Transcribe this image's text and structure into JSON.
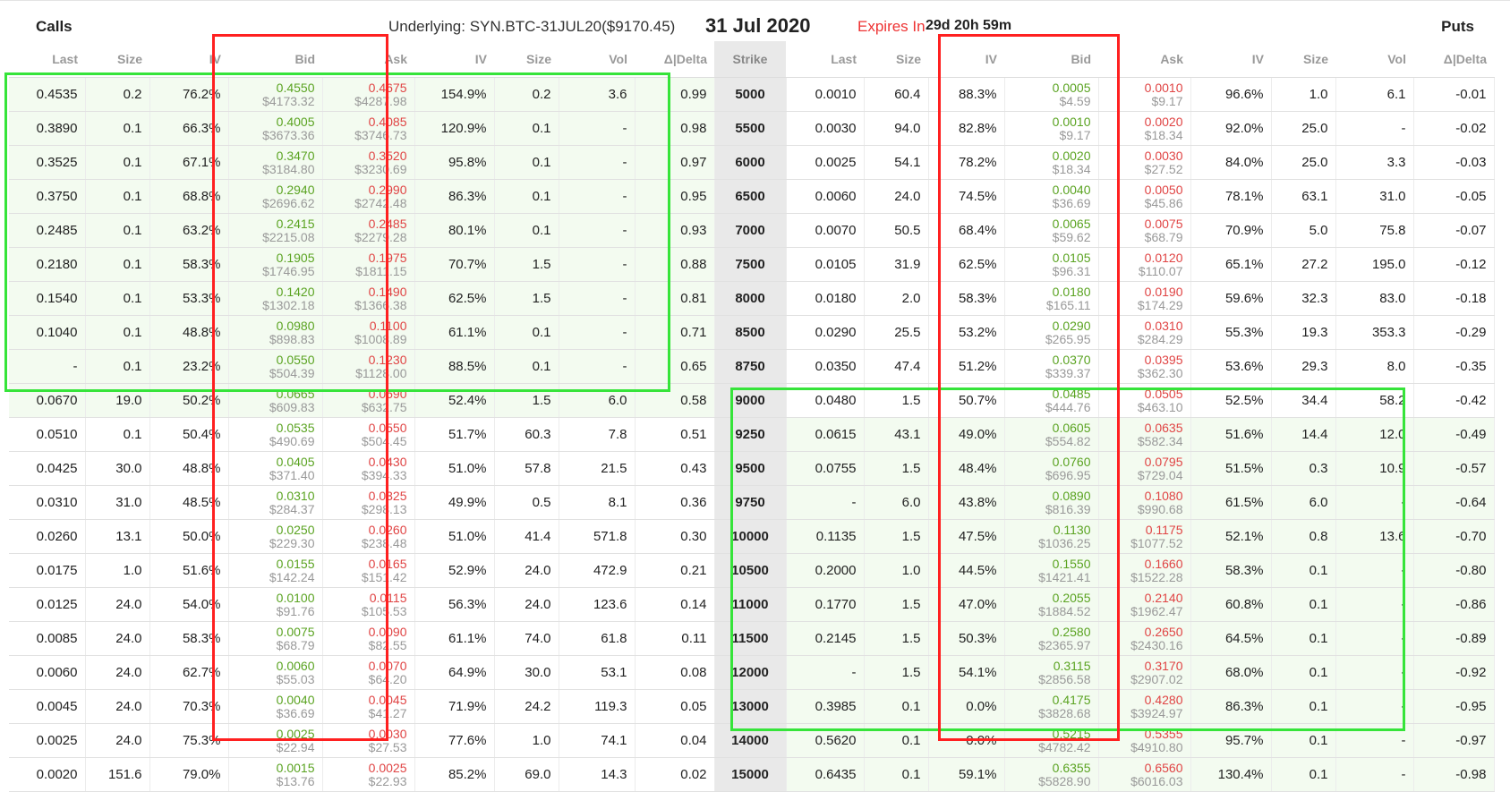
{
  "header": {
    "calls_label": "Calls",
    "puts_label": "Puts",
    "underlying": "Underlying: SYN.BTC-31JUL20($9170.45)",
    "expiry_date": "31 Jul 2020",
    "expires_in_label": "Expires In",
    "expires_in_value": "29d 20h 59m"
  },
  "columns": {
    "calls": [
      "Last",
      "Size",
      "IV",
      "Bid",
      "Ask",
      "IV",
      "Size",
      "Vol",
      "Δ|Delta"
    ],
    "strike": "Strike",
    "puts": [
      "Last",
      "Size",
      "IV",
      "Bid",
      "Ask",
      "IV",
      "Size",
      "Vol",
      "Δ|Delta"
    ]
  },
  "colors": {
    "bid": "#5aa321",
    "ask": "#e04444",
    "highlight_red": "#ff2020",
    "highlight_green": "#36e43a",
    "itm_background": "#f3fbf0"
  },
  "rows": [
    {
      "strike": "5000",
      "call": {
        "last": "0.4535",
        "size": "0.2",
        "iv": "76.2%",
        "bid": "0.4550",
        "bid_usd": "$4173.32",
        "ask": "0.4675",
        "ask_usd": "$4287.98",
        "ask_iv": "154.9%",
        "ask_size": "0.2",
        "vol": "3.6",
        "delta": "0.99"
      },
      "put": {
        "last": "0.0010",
        "size": "60.4",
        "iv": "88.3%",
        "bid": "0.0005",
        "bid_usd": "$4.59",
        "ask": "0.0010",
        "ask_usd": "$9.17",
        "ask_iv": "96.6%",
        "ask_size": "1.0",
        "vol": "6.1",
        "delta": "-0.01"
      }
    },
    {
      "strike": "5500",
      "call": {
        "last": "0.3890",
        "size": "0.1",
        "iv": "66.3%",
        "bid": "0.4005",
        "bid_usd": "$3673.36",
        "ask": "0.4085",
        "ask_usd": "$3746.73",
        "ask_iv": "120.9%",
        "ask_size": "0.1",
        "vol": "-",
        "delta": "0.98"
      },
      "put": {
        "last": "0.0030",
        "size": "94.0",
        "iv": "82.8%",
        "bid": "0.0010",
        "bid_usd": "$9.17",
        "ask": "0.0020",
        "ask_usd": "$18.34",
        "ask_iv": "92.0%",
        "ask_size": "25.0",
        "vol": "-",
        "delta": "-0.02"
      }
    },
    {
      "strike": "6000",
      "call": {
        "last": "0.3525",
        "size": "0.1",
        "iv": "67.1%",
        "bid": "0.3470",
        "bid_usd": "$3184.80",
        "ask": "0.3520",
        "ask_usd": "$3230.69",
        "ask_iv": "95.8%",
        "ask_size": "0.1",
        "vol": "-",
        "delta": "0.97"
      },
      "put": {
        "last": "0.0025",
        "size": "54.1",
        "iv": "78.2%",
        "bid": "0.0020",
        "bid_usd": "$18.34",
        "ask": "0.0030",
        "ask_usd": "$27.52",
        "ask_iv": "84.0%",
        "ask_size": "25.0",
        "vol": "3.3",
        "delta": "-0.03"
      }
    },
    {
      "strike": "6500",
      "call": {
        "last": "0.3750",
        "size": "0.1",
        "iv": "68.8%",
        "bid": "0.2940",
        "bid_usd": "$2696.62",
        "ask": "0.2990",
        "ask_usd": "$2742.48",
        "ask_iv": "86.3%",
        "ask_size": "0.1",
        "vol": "-",
        "delta": "0.95"
      },
      "put": {
        "last": "0.0060",
        "size": "24.0",
        "iv": "74.5%",
        "bid": "0.0040",
        "bid_usd": "$36.69",
        "ask": "0.0050",
        "ask_usd": "$45.86",
        "ask_iv": "78.1%",
        "ask_size": "63.1",
        "vol": "31.0",
        "delta": "-0.05"
      }
    },
    {
      "strike": "7000",
      "call": {
        "last": "0.2485",
        "size": "0.1",
        "iv": "63.2%",
        "bid": "0.2415",
        "bid_usd": "$2215.08",
        "ask": "0.2485",
        "ask_usd": "$2279.28",
        "ask_iv": "80.1%",
        "ask_size": "0.1",
        "vol": "-",
        "delta": "0.93"
      },
      "put": {
        "last": "0.0070",
        "size": "50.5",
        "iv": "68.4%",
        "bid": "0.0065",
        "bid_usd": "$59.62",
        "ask": "0.0075",
        "ask_usd": "$68.79",
        "ask_iv": "70.9%",
        "ask_size": "5.0",
        "vol": "75.8",
        "delta": "-0.07"
      }
    },
    {
      "strike": "7500",
      "call": {
        "last": "0.2180",
        "size": "0.1",
        "iv": "58.3%",
        "bid": "0.1905",
        "bid_usd": "$1746.95",
        "ask": "0.1975",
        "ask_usd": "$1811.15",
        "ask_iv": "70.7%",
        "ask_size": "1.5",
        "vol": "-",
        "delta": "0.88"
      },
      "put": {
        "last": "0.0105",
        "size": "31.9",
        "iv": "62.5%",
        "bid": "0.0105",
        "bid_usd": "$96.31",
        "ask": "0.0120",
        "ask_usd": "$110.07",
        "ask_iv": "65.1%",
        "ask_size": "27.2",
        "vol": "195.0",
        "delta": "-0.12"
      }
    },
    {
      "strike": "8000",
      "call": {
        "last": "0.1540",
        "size": "0.1",
        "iv": "53.3%",
        "bid": "0.1420",
        "bid_usd": "$1302.18",
        "ask": "0.1490",
        "ask_usd": "$1366.38",
        "ask_iv": "62.5%",
        "ask_size": "1.5",
        "vol": "-",
        "delta": "0.81"
      },
      "put": {
        "last": "0.0180",
        "size": "2.0",
        "iv": "58.3%",
        "bid": "0.0180",
        "bid_usd": "$165.11",
        "ask": "0.0190",
        "ask_usd": "$174.29",
        "ask_iv": "59.6%",
        "ask_size": "32.3",
        "vol": "83.0",
        "delta": "-0.18"
      }
    },
    {
      "strike": "8500",
      "call": {
        "last": "0.1040",
        "size": "0.1",
        "iv": "48.8%",
        "bid": "0.0980",
        "bid_usd": "$898.83",
        "ask": "0.1100",
        "ask_usd": "$1008.89",
        "ask_iv": "61.1%",
        "ask_size": "0.1",
        "vol": "-",
        "delta": "0.71"
      },
      "put": {
        "last": "0.0290",
        "size": "25.5",
        "iv": "53.2%",
        "bid": "0.0290",
        "bid_usd": "$265.95",
        "ask": "0.0310",
        "ask_usd": "$284.29",
        "ask_iv": "55.3%",
        "ask_size": "19.3",
        "vol": "353.3",
        "delta": "-0.29"
      }
    },
    {
      "strike": "8750",
      "call": {
        "last": "-",
        "size": "0.1",
        "iv": "23.2%",
        "bid": "0.0550",
        "bid_usd": "$504.39",
        "ask": "0.1230",
        "ask_usd": "$1128.00",
        "ask_iv": "88.5%",
        "ask_size": "0.1",
        "vol": "-",
        "delta": "0.65"
      },
      "put": {
        "last": "0.0350",
        "size": "47.4",
        "iv": "51.2%",
        "bid": "0.0370",
        "bid_usd": "$339.37",
        "ask": "0.0395",
        "ask_usd": "$362.30",
        "ask_iv": "53.6%",
        "ask_size": "29.3",
        "vol": "8.0",
        "delta": "-0.35"
      }
    },
    {
      "strike": "9000",
      "call": {
        "last": "0.0670",
        "size": "19.0",
        "iv": "50.2%",
        "bid": "0.0665",
        "bid_usd": "$609.83",
        "ask": "0.0690",
        "ask_usd": "$632.75",
        "ask_iv": "52.4%",
        "ask_size": "1.5",
        "vol": "6.0",
        "delta": "0.58"
      },
      "put": {
        "last": "0.0480",
        "size": "1.5",
        "iv": "50.7%",
        "bid": "0.0485",
        "bid_usd": "$444.76",
        "ask": "0.0505",
        "ask_usd": "$463.10",
        "ask_iv": "52.5%",
        "ask_size": "34.4",
        "vol": "58.2",
        "delta": "-0.42"
      }
    },
    {
      "strike": "9250",
      "call": {
        "last": "0.0510",
        "size": "0.1",
        "iv": "50.4%",
        "bid": "0.0535",
        "bid_usd": "$490.69",
        "ask": "0.0550",
        "ask_usd": "$504.45",
        "ask_iv": "51.7%",
        "ask_size": "60.3",
        "vol": "7.8",
        "delta": "0.51"
      },
      "put": {
        "last": "0.0615",
        "size": "43.1",
        "iv": "49.0%",
        "bid": "0.0605",
        "bid_usd": "$554.82",
        "ask": "0.0635",
        "ask_usd": "$582.34",
        "ask_iv": "51.6%",
        "ask_size": "14.4",
        "vol": "12.0",
        "delta": "-0.49"
      }
    },
    {
      "strike": "9500",
      "call": {
        "last": "0.0425",
        "size": "30.0",
        "iv": "48.8%",
        "bid": "0.0405",
        "bid_usd": "$371.40",
        "ask": "0.0430",
        "ask_usd": "$394.33",
        "ask_iv": "51.0%",
        "ask_size": "57.8",
        "vol": "21.5",
        "delta": "0.43"
      },
      "put": {
        "last": "0.0755",
        "size": "1.5",
        "iv": "48.4%",
        "bid": "0.0760",
        "bid_usd": "$696.95",
        "ask": "0.0795",
        "ask_usd": "$729.04",
        "ask_iv": "51.5%",
        "ask_size": "0.3",
        "vol": "10.9",
        "delta": "-0.57"
      }
    },
    {
      "strike": "9750",
      "call": {
        "last": "0.0310",
        "size": "31.0",
        "iv": "48.5%",
        "bid": "0.0310",
        "bid_usd": "$284.37",
        "ask": "0.0325",
        "ask_usd": "$298.13",
        "ask_iv": "49.9%",
        "ask_size": "0.5",
        "vol": "8.1",
        "delta": "0.36"
      },
      "put": {
        "last": "-",
        "size": "6.0",
        "iv": "43.8%",
        "bid": "0.0890",
        "bid_usd": "$816.39",
        "ask": "0.1080",
        "ask_usd": "$990.68",
        "ask_iv": "61.5%",
        "ask_size": "6.0",
        "vol": "-",
        "delta": "-0.64"
      }
    },
    {
      "strike": "10000",
      "call": {
        "last": "0.0260",
        "size": "13.1",
        "iv": "50.0%",
        "bid": "0.0250",
        "bid_usd": "$229.30",
        "ask": "0.0260",
        "ask_usd": "$238.48",
        "ask_iv": "51.0%",
        "ask_size": "41.4",
        "vol": "571.8",
        "delta": "0.30"
      },
      "put": {
        "last": "0.1135",
        "size": "1.5",
        "iv": "47.5%",
        "bid": "0.1130",
        "bid_usd": "$1036.25",
        "ask": "0.1175",
        "ask_usd": "$1077.52",
        "ask_iv": "52.1%",
        "ask_size": "0.8",
        "vol": "13.6",
        "delta": "-0.70"
      }
    },
    {
      "strike": "10500",
      "call": {
        "last": "0.0175",
        "size": "1.0",
        "iv": "51.6%",
        "bid": "0.0155",
        "bid_usd": "$142.24",
        "ask": "0.0165",
        "ask_usd": "$151.42",
        "ask_iv": "52.9%",
        "ask_size": "24.0",
        "vol": "472.9",
        "delta": "0.21"
      },
      "put": {
        "last": "0.2000",
        "size": "1.0",
        "iv": "44.5%",
        "bid": "0.1550",
        "bid_usd": "$1421.41",
        "ask": "0.1660",
        "ask_usd": "$1522.28",
        "ask_iv": "58.3%",
        "ask_size": "0.1",
        "vol": "-",
        "delta": "-0.80"
      }
    },
    {
      "strike": "11000",
      "call": {
        "last": "0.0125",
        "size": "24.0",
        "iv": "54.0%",
        "bid": "0.0100",
        "bid_usd": "$91.76",
        "ask": "0.0115",
        "ask_usd": "$105.53",
        "ask_iv": "56.3%",
        "ask_size": "24.0",
        "vol": "123.6",
        "delta": "0.14"
      },
      "put": {
        "last": "0.1770",
        "size": "1.5",
        "iv": "47.0%",
        "bid": "0.2055",
        "bid_usd": "$1884.52",
        "ask": "0.2140",
        "ask_usd": "$1962.47",
        "ask_iv": "60.8%",
        "ask_size": "0.1",
        "vol": "-",
        "delta": "-0.86"
      }
    },
    {
      "strike": "11500",
      "call": {
        "last": "0.0085",
        "size": "24.0",
        "iv": "58.3%",
        "bid": "0.0075",
        "bid_usd": "$68.79",
        "ask": "0.0090",
        "ask_usd": "$82.55",
        "ask_iv": "61.1%",
        "ask_size": "74.0",
        "vol": "61.8",
        "delta": "0.11"
      },
      "put": {
        "last": "0.2145",
        "size": "1.5",
        "iv": "50.3%",
        "bid": "0.2580",
        "bid_usd": "$2365.97",
        "ask": "0.2650",
        "ask_usd": "$2430.16",
        "ask_iv": "64.5%",
        "ask_size": "0.1",
        "vol": "-",
        "delta": "-0.89"
      }
    },
    {
      "strike": "12000",
      "call": {
        "last": "0.0060",
        "size": "24.0",
        "iv": "62.7%",
        "bid": "0.0060",
        "bid_usd": "$55.03",
        "ask": "0.0070",
        "ask_usd": "$64.20",
        "ask_iv": "64.9%",
        "ask_size": "30.0",
        "vol": "53.1",
        "delta": "0.08"
      },
      "put": {
        "last": "-",
        "size": "1.5",
        "iv": "54.1%",
        "bid": "0.3115",
        "bid_usd": "$2856.58",
        "ask": "0.3170",
        "ask_usd": "$2907.02",
        "ask_iv": "68.0%",
        "ask_size": "0.1",
        "vol": "-",
        "delta": "-0.92"
      }
    },
    {
      "strike": "13000",
      "call": {
        "last": "0.0045",
        "size": "24.0",
        "iv": "70.3%",
        "bid": "0.0040",
        "bid_usd": "$36.69",
        "ask": "0.0045",
        "ask_usd": "$41.27",
        "ask_iv": "71.9%",
        "ask_size": "24.2",
        "vol": "119.3",
        "delta": "0.05"
      },
      "put": {
        "last": "0.3985",
        "size": "0.1",
        "iv": "0.0%",
        "bid": "0.4175",
        "bid_usd": "$3828.68",
        "ask": "0.4280",
        "ask_usd": "$3924.97",
        "ask_iv": "86.3%",
        "ask_size": "0.1",
        "vol": "-",
        "delta": "-0.95"
      }
    },
    {
      "strike": "14000",
      "call": {
        "last": "0.0025",
        "size": "24.0",
        "iv": "75.3%",
        "bid": "0.0025",
        "bid_usd": "$22.94",
        "ask": "0.0030",
        "ask_usd": "$27.53",
        "ask_iv": "77.6%",
        "ask_size": "1.0",
        "vol": "74.1",
        "delta": "0.04"
      },
      "put": {
        "last": "0.5620",
        "size": "0.1",
        "iv": "0.0%",
        "bid": "0.5215",
        "bid_usd": "$4782.42",
        "ask": "0.5355",
        "ask_usd": "$4910.80",
        "ask_iv": "95.7%",
        "ask_size": "0.1",
        "vol": "-",
        "delta": "-0.97"
      }
    },
    {
      "strike": "15000",
      "call": {
        "last": "0.0020",
        "size": "151.6",
        "iv": "79.0%",
        "bid": "0.0015",
        "bid_usd": "$13.76",
        "ask": "0.0025",
        "ask_usd": "$22.93",
        "ask_iv": "85.2%",
        "ask_size": "69.0",
        "vol": "14.3",
        "delta": "0.02"
      },
      "put": {
        "last": "0.6435",
        "size": "0.1",
        "iv": "59.1%",
        "bid": "0.6355",
        "bid_usd": "$5828.90",
        "ask": "0.6560",
        "ask_usd": "$6016.03",
        "ask_iv": "130.4%",
        "ask_size": "0.1",
        "vol": "-",
        "delta": "-0.98"
      }
    }
  ]
}
